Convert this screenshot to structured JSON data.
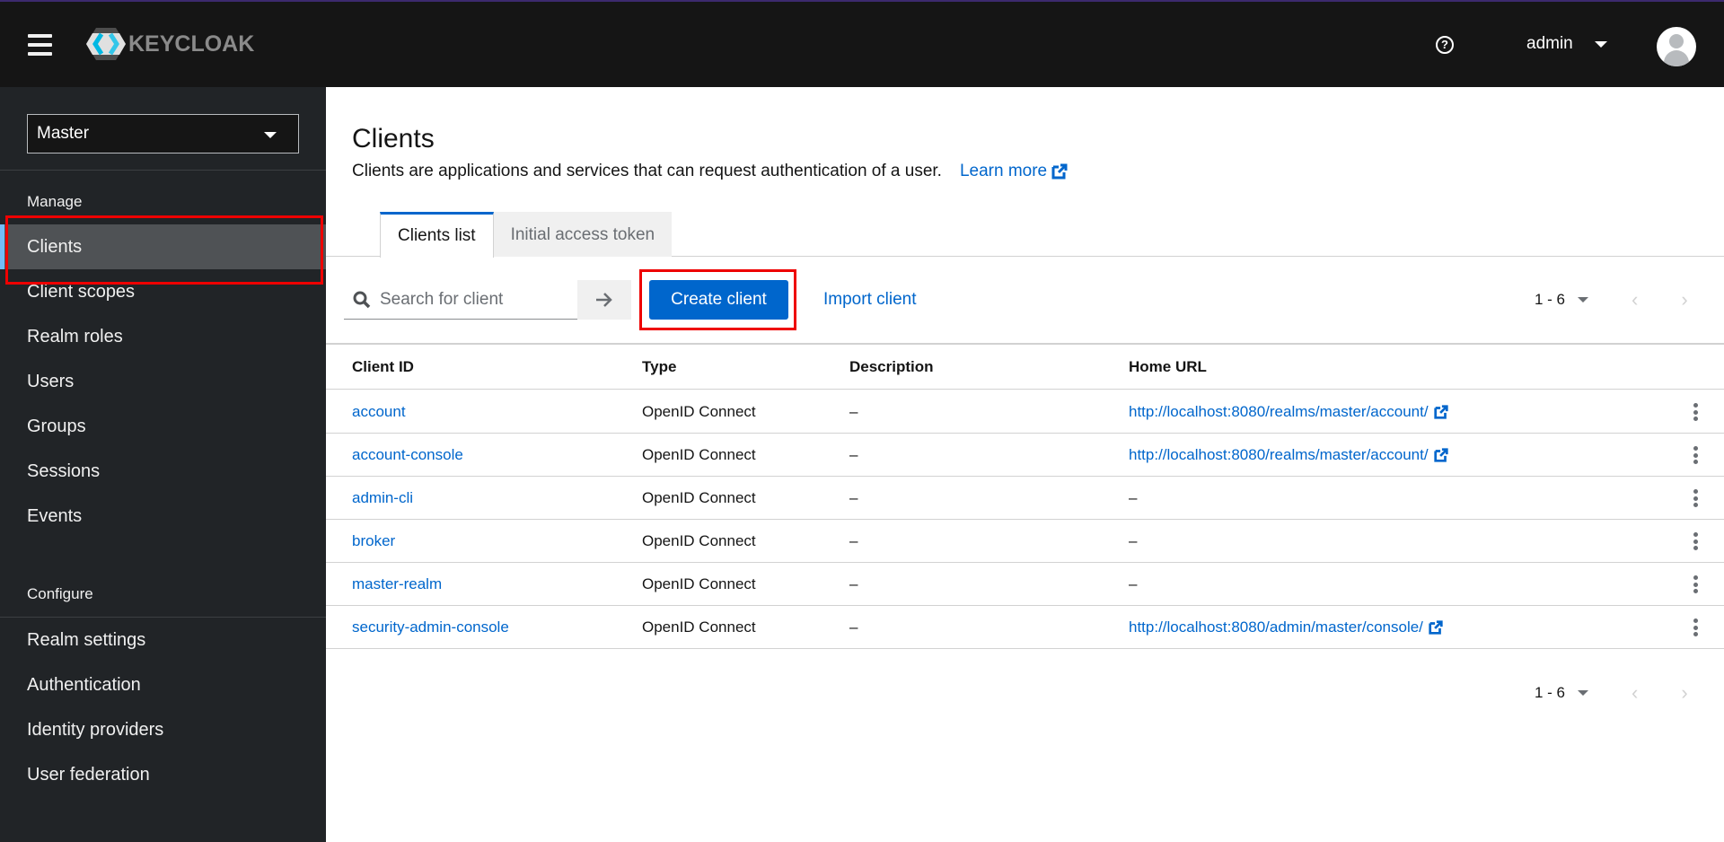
{
  "header": {
    "brand": "KEYCLOAK",
    "user_name": "admin",
    "icons": {
      "menu": "hamburger-icon",
      "help": "help-circle-icon",
      "user_caret": "caret-down-icon",
      "avatar": "user-avatar-icon"
    }
  },
  "sidebar": {
    "realm_selector": "Master",
    "sections": [
      {
        "label": "Manage",
        "items": [
          "Clients",
          "Client scopes",
          "Realm roles",
          "Users",
          "Groups",
          "Sessions",
          "Events"
        ]
      },
      {
        "label": "Configure",
        "items": [
          "Realm settings",
          "Authentication",
          "Identity providers",
          "User federation"
        ]
      }
    ],
    "active_item": "Clients"
  },
  "main": {
    "title": "Clients",
    "description": "Clients are applications and services that can request authentication of a user.",
    "learn_more": "Learn more",
    "tabs": [
      {
        "label": "Clients list",
        "active": true
      },
      {
        "label": "Initial access token",
        "active": false
      }
    ],
    "toolbar": {
      "search_placeholder": "Search for client",
      "search_value": "",
      "create_label": "Create client",
      "import_label": "Import client"
    },
    "pagination": {
      "range": "1 - 6",
      "prev": "‹",
      "next": "›"
    },
    "table": {
      "columns": [
        "Client ID",
        "Type",
        "Description",
        "Home URL"
      ],
      "rows": [
        {
          "client_id": "account",
          "type": "OpenID Connect",
          "description": "–",
          "home_url": "http://localhost:8080/realms/master/account/",
          "external": true
        },
        {
          "client_id": "account-console",
          "type": "OpenID Connect",
          "description": "–",
          "home_url": "http://localhost:8080/realms/master/account/",
          "external": true
        },
        {
          "client_id": "admin-cli",
          "type": "OpenID Connect",
          "description": "–",
          "home_url": "–",
          "external": false
        },
        {
          "client_id": "broker",
          "type": "OpenID Connect",
          "description": "–",
          "home_url": "–",
          "external": false
        },
        {
          "client_id": "master-realm",
          "type": "OpenID Connect",
          "description": "–",
          "home_url": "–",
          "external": false
        },
        {
          "client_id": "security-admin-console",
          "type": "OpenID Connect",
          "description": "–",
          "home_url": "http://localhost:8080/admin/master/console/",
          "external": true
        }
      ]
    }
  },
  "colors": {
    "primary": "#0066cc",
    "header_bg": "#151515",
    "sidebar_bg": "#212427",
    "active_nav": "#4f5255",
    "annotation": "#ee0000"
  }
}
